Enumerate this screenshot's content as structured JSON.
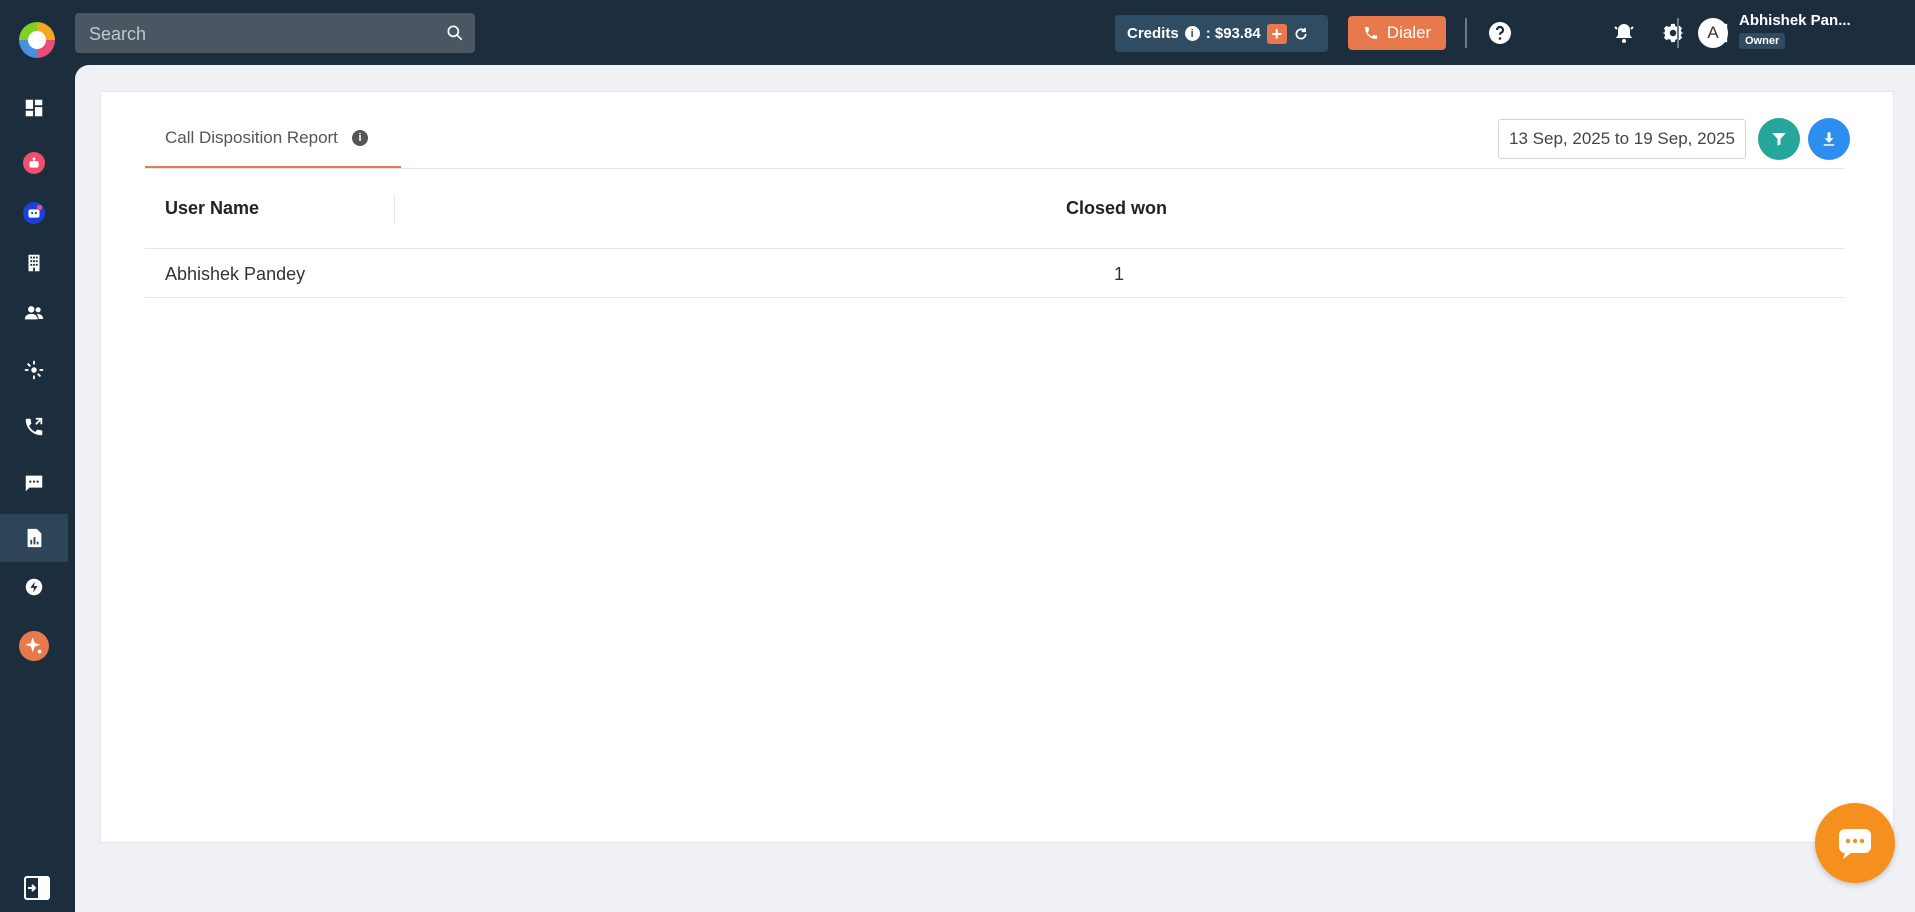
{
  "topbar": {
    "search_placeholder": "Search",
    "credits_label": "Credits",
    "credits_value": ": $93.84",
    "dialer_label": "Dialer",
    "user_initial": "A",
    "user_name": "Abhishek Pan...",
    "user_role": "Owner"
  },
  "sidebar": {
    "items": [
      {
        "icon": "dashboard-icon"
      },
      {
        "icon": "bot-icon",
        "color": "#f0506e"
      },
      {
        "icon": "chatbot-icon",
        "color": "#1e3fd8"
      },
      {
        "icon": "building-icon"
      },
      {
        "icon": "contacts-icon"
      },
      {
        "icon": "integrations-icon"
      },
      {
        "icon": "call-transfer-icon"
      },
      {
        "icon": "messages-icon"
      },
      {
        "icon": "reports-icon",
        "active": true
      },
      {
        "icon": "automation-icon"
      },
      {
        "icon": "ai-sparkle-icon",
        "color": "#e8794c"
      }
    ],
    "bottom_icon": "collapse-sidebar-icon"
  },
  "report": {
    "tab_label": "Call Disposition Report",
    "info_glyph": "i",
    "date_range": "13 Sep, 2025 to 19 Sep, 2025",
    "columns": [
      "User Name",
      "Closed won"
    ],
    "rows": [
      {
        "user_name": "Abhishek Pandey",
        "closed_won": "1"
      }
    ]
  },
  "colors": {
    "sidebar_bg": "#1c2e3e",
    "accent_orange": "#e8794c",
    "filter_teal": "#26a69a",
    "download_blue": "#2e8ef0",
    "chat_orange": "#f5901e"
  }
}
